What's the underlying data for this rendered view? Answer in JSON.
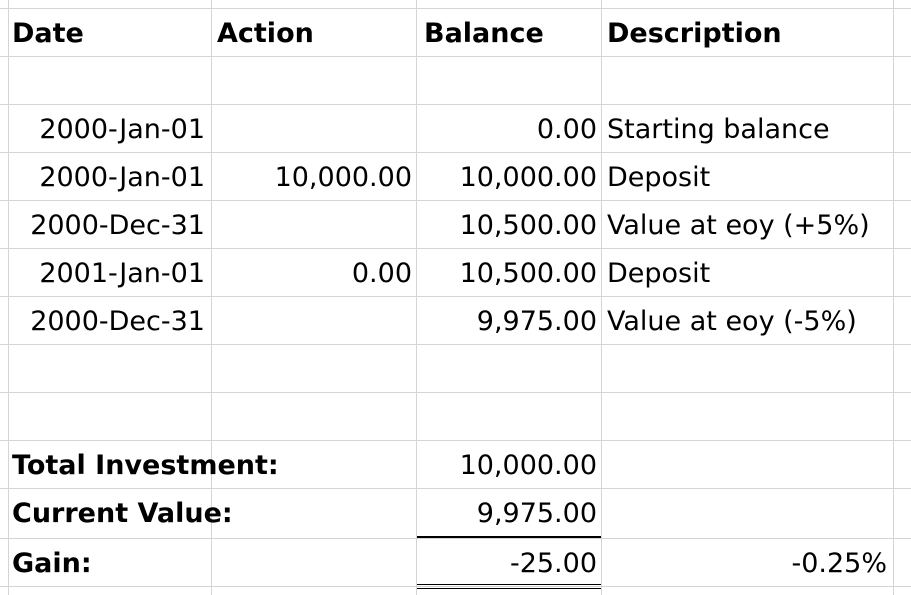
{
  "headers": {
    "date": "Date",
    "action": "Action",
    "balance": "Balance",
    "description": "Description"
  },
  "rows": [
    {
      "date": "2000-Jan-01",
      "action": "",
      "balance": "0.00",
      "description": "Starting balance"
    },
    {
      "date": "2000-Jan-01",
      "action": "10,000.00",
      "balance": "10,000.00",
      "description": "Deposit"
    },
    {
      "date": "2000-Dec-31",
      "action": "",
      "balance": "10,500.00",
      "description": "Value at eoy (+5%)"
    },
    {
      "date": "2001-Jan-01",
      "action": "0.00",
      "balance": "10,500.00",
      "description": "Deposit"
    },
    {
      "date": "2000-Dec-31",
      "action": "",
      "balance": "9,975.00",
      "description": "Value at eoy (-5%)"
    }
  ],
  "summary": {
    "total_label": "Total Investment:",
    "total_value": "10,000.00",
    "current_label": "Current Value:",
    "current_value": "9,975.00",
    "gain_label": "Gain:",
    "gain_value": "-25.00",
    "gain_percent": "-0.25%"
  }
}
